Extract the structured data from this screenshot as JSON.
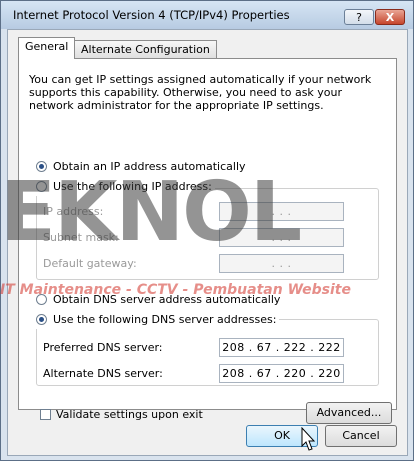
{
  "window": {
    "title": "Internet Protocol Version 4 (TCP/IPv4) Properties",
    "help_label": "?",
    "close_label": "X"
  },
  "tabs": [
    {
      "label": "General",
      "active": true
    },
    {
      "label": "Alternate Configuration",
      "active": false
    }
  ],
  "general": {
    "description": "You can get IP settings assigned automatically if your network supports this capability. Otherwise, you need to ask your network administrator for the appropriate IP settings.",
    "ip_auto_label": "Obtain an IP address automatically",
    "ip_manual_label": "Use the following IP address:",
    "ip_mode": "auto",
    "ip_address_label": "IP address:",
    "subnet_mask_label": "Subnet mask:",
    "default_gateway_label": "Default gateway:",
    "ip_address_value": ".       .       .",
    "subnet_mask_value": ".       .       .",
    "default_gateway_value": ".       .       .",
    "dns_auto_label": "Obtain DNS server address automatically",
    "dns_manual_label": "Use the following DNS server addresses:",
    "dns_mode": "manual",
    "preferred_dns_label": "Preferred DNS server:",
    "preferred_dns_value": "208 .  67  . 222 . 222",
    "alternate_dns_label": "Alternate DNS server:",
    "alternate_dns_value": "208 .  67  . 220 . 220",
    "validate_label": "Validate settings upon exit",
    "validate_checked": false,
    "advanced_label": "Advanced..."
  },
  "footer": {
    "ok_label": "OK",
    "cancel_label": "Cancel"
  },
  "watermark": {
    "logo_text": "EKNOL",
    "tagline": "IT Maintenance - CCTV - Pembuatan Website"
  }
}
